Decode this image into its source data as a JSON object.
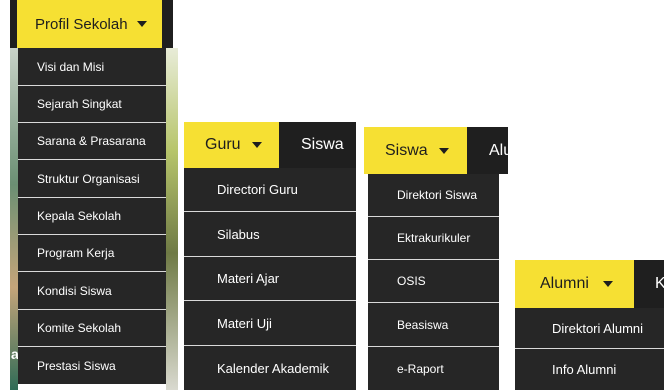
{
  "colors": {
    "accent_yellow": "#f6e033",
    "bar_dark": "#1f1f1f",
    "menu_dark": "#262626",
    "divider": "#d9d9d9",
    "text_light": "#ffffff"
  },
  "profil": {
    "label": "Profil Sekolah",
    "items": [
      "Visi dan Misi",
      "Sejarah Singkat",
      "Sarana & Prasarana",
      "Struktur Organisasi",
      "Kepala Sekolah",
      "Program Kerja",
      "Kondisi Siswa",
      "Komite Sekolah",
      "Prestasi Siswa"
    ],
    "bg_text": "a"
  },
  "guru": {
    "label": "Guru",
    "next": "Siswa",
    "items": [
      "Directori Guru",
      "Silabus",
      "Materi Ajar",
      "Materi Uji",
      "Kalender Akademik"
    ]
  },
  "siswa": {
    "label": "Siswa",
    "next": "Alu",
    "items": [
      "Direktori Siswa",
      "Ektrakurikuler",
      "OSIS",
      "Beasiswa",
      "e-Raport"
    ]
  },
  "alumni": {
    "label": "Alumni",
    "next": "K",
    "items": [
      "Direktori Alumni",
      "Info Alumni"
    ]
  }
}
